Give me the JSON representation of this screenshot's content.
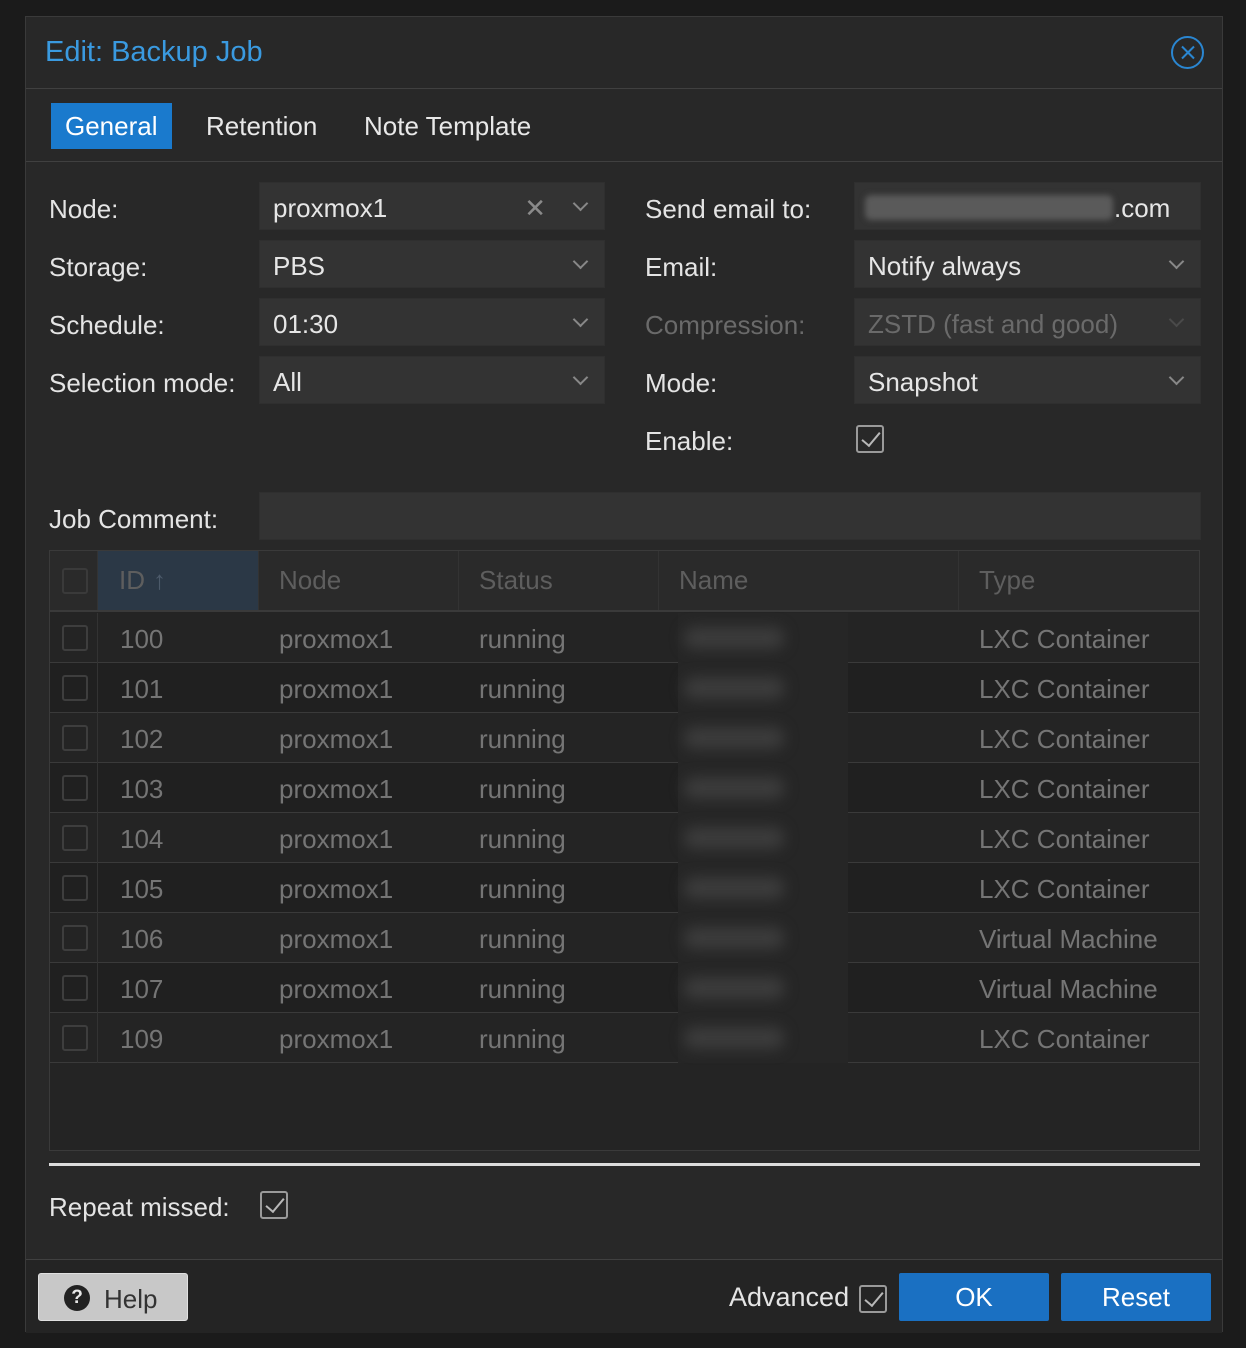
{
  "dialog": {
    "title": "Edit: Backup Job"
  },
  "tabs": [
    {
      "label": "General",
      "active": true
    },
    {
      "label": "Retention",
      "active": false
    },
    {
      "label": "Note Template",
      "active": false
    }
  ],
  "form": {
    "node": {
      "label": "Node:",
      "value": "proxmox1"
    },
    "storage": {
      "label": "Storage:",
      "value": "PBS"
    },
    "schedule": {
      "label": "Schedule:",
      "value": "01:30"
    },
    "selection_mode": {
      "label": "Selection mode:",
      "value": "All"
    },
    "send_email_to": {
      "label": "Send email to:",
      "value_suffix": ".com"
    },
    "email": {
      "label": "Email:",
      "value": "Notify always"
    },
    "compression": {
      "label": "Compression:",
      "value": "ZSTD (fast and good)"
    },
    "mode": {
      "label": "Mode:",
      "value": "Snapshot"
    },
    "enable": {
      "label": "Enable:",
      "checked": true
    },
    "job_comment": {
      "label": "Job Comment:",
      "value": ""
    },
    "repeat_missed": {
      "label": "Repeat missed:",
      "checked": true
    }
  },
  "grid": {
    "columns": [
      "ID",
      "Node",
      "Status",
      "Name",
      "Type"
    ],
    "sorted_column": "ID",
    "rows": [
      {
        "id": "100",
        "node": "proxmox1",
        "status": "running",
        "type": "LXC Container"
      },
      {
        "id": "101",
        "node": "proxmox1",
        "status": "running",
        "type": "LXC Container"
      },
      {
        "id": "102",
        "node": "proxmox1",
        "status": "running",
        "type": "LXC Container"
      },
      {
        "id": "103",
        "node": "proxmox1",
        "status": "running",
        "type": "LXC Container"
      },
      {
        "id": "104",
        "node": "proxmox1",
        "status": "running",
        "type": "LXC Container"
      },
      {
        "id": "105",
        "node": "proxmox1",
        "status": "running",
        "type": "LXC Container"
      },
      {
        "id": "106",
        "node": "proxmox1",
        "status": "running",
        "type": "Virtual Machine"
      },
      {
        "id": "107",
        "node": "proxmox1",
        "status": "running",
        "type": "Virtual Machine"
      },
      {
        "id": "109",
        "node": "proxmox1",
        "status": "running",
        "type": "LXC Container"
      }
    ]
  },
  "footer": {
    "help_label": "Help",
    "advanced_label": "Advanced",
    "advanced_checked": true,
    "ok_label": "OK",
    "reset_label": "Reset"
  },
  "colors": {
    "accent": "#1a7acd",
    "title": "#3a9ae0",
    "background": "#282828"
  }
}
